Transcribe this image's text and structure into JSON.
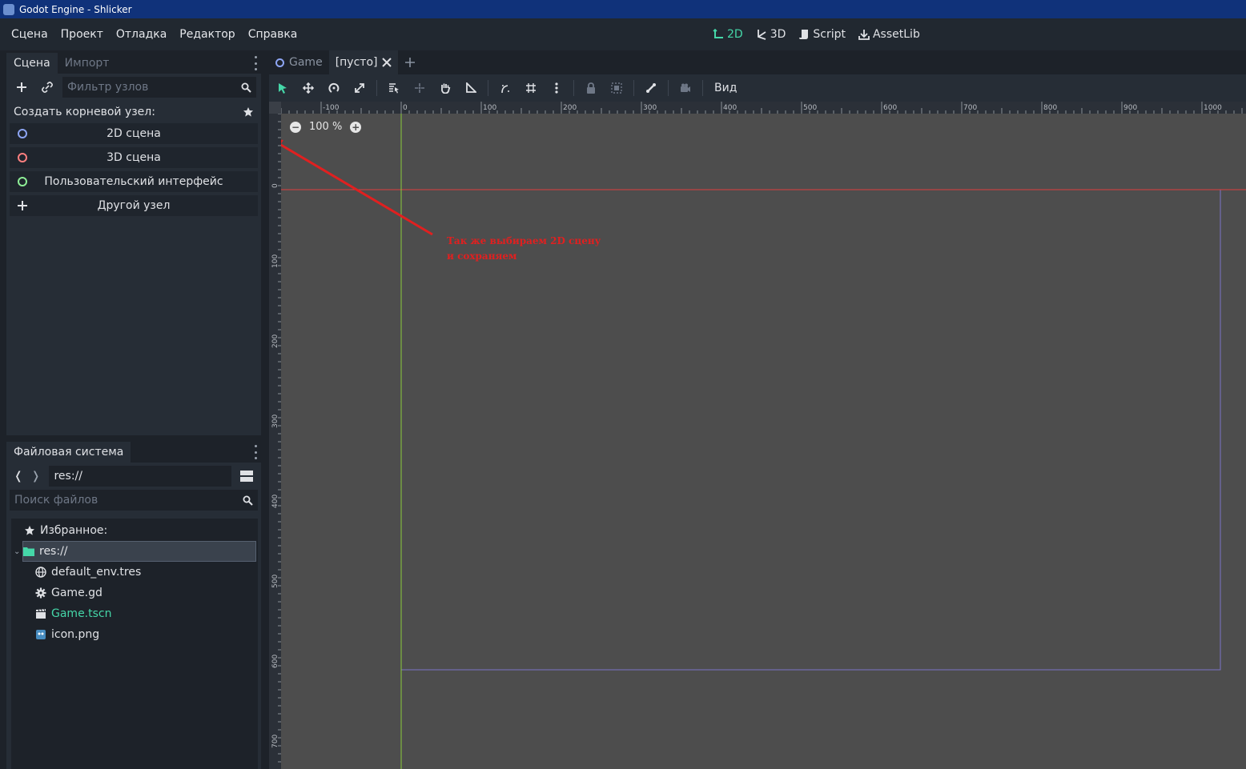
{
  "window": {
    "title": "Godot Engine - Shlicker"
  },
  "menubar": {
    "items": [
      "Сцена",
      "Проект",
      "Отладка",
      "Редактор",
      "Справка"
    ],
    "main_tabs": [
      {
        "label": "2D",
        "icon": "2d-icon",
        "active": true
      },
      {
        "label": "3D",
        "icon": "3d-icon",
        "active": false
      },
      {
        "label": "Script",
        "icon": "script-icon",
        "active": false
      },
      {
        "label": "AssetLib",
        "icon": "assetlib-icon",
        "active": false
      }
    ]
  },
  "scene_dock": {
    "tabs": [
      "Сцена",
      "Импорт"
    ],
    "filter_placeholder": "Фильтр узлов",
    "create_root_label": "Создать корневой узел:",
    "root_buttons": [
      {
        "label": "2D сцена",
        "color": "#8da5f3"
      },
      {
        "label": "3D сцена",
        "color": "#fc7f7f"
      },
      {
        "label": "Пользовательский интерфейс",
        "color": "#8eef97"
      },
      {
        "label": "Другой узел",
        "color": "#dfe1e5"
      }
    ]
  },
  "filesystem_dock": {
    "tab": "Файловая система",
    "path": "res://",
    "search_placeholder": "Поиск файлов",
    "favorites_label": "Избранное:",
    "root": "res://",
    "files": [
      {
        "name": "default_env.tres",
        "icon": "globe-icon"
      },
      {
        "name": "Game.gd",
        "icon": "gear-icon"
      },
      {
        "name": "Game.tscn",
        "icon": "clapperboard-icon",
        "color": "#45d7a8"
      },
      {
        "name": "icon.png",
        "icon": "image-icon"
      }
    ]
  },
  "editor_tabs": {
    "tabs": [
      {
        "label": "Game",
        "active": false
      },
      {
        "label": "[пусто]",
        "active": true
      }
    ]
  },
  "toolbar": {
    "view_label": "Вид"
  },
  "viewport": {
    "zoom": "100 %",
    "ruler_x_labels": [
      "-100",
      "0",
      "100",
      "200",
      "300",
      "400",
      "500",
      "600",
      "700",
      "800",
      "900",
      "1000"
    ],
    "ruler_y_labels": [
      "0",
      "100",
      "200",
      "300",
      "400",
      "500",
      "600",
      "700"
    ],
    "annotation_line1": "Так же выбираем 2D сцену",
    "annotation_line2": "и сохраняем"
  },
  "colors": {
    "accent": "#45d7a8",
    "annotation": "#e02020"
  }
}
